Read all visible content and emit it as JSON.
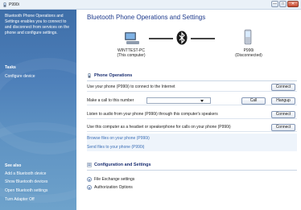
{
  "window": {
    "title": "P990i",
    "minimize": "—",
    "maximize": "□",
    "close": "✕"
  },
  "sidebar": {
    "description": "Bluetooth Phone Operations and Settings enables you to connect to and disconnect from services on the phone and configure settings.",
    "tasks_heading": "Tasks",
    "tasks": [
      {
        "label": "Configure device"
      }
    ],
    "see_also_heading": "See also",
    "see_also": [
      {
        "label": "Add a Bluetooth device"
      },
      {
        "label": "Show Bluetooth devices"
      },
      {
        "label": "Open Bluetooth settings"
      },
      {
        "label": "Turn Adapter Off"
      }
    ]
  },
  "main": {
    "title": "Bluetooth Phone Operations and Settings",
    "computer": {
      "name": "WINTTEST-PC",
      "role": "(This computer)"
    },
    "phone": {
      "name": "P990i",
      "status": "(Disconnected)"
    },
    "phone_ops": {
      "heading": "Phone Operations",
      "rows": {
        "internet": {
          "text": "Use your phone (P990i) to connect to the Internet",
          "button": "Connect"
        },
        "call": {
          "text": "Make a call to this number",
          "number_value": "",
          "call_button": "Call",
          "hangup_button": "Hangup"
        },
        "listen": {
          "text": "Listen to audio from your phone (P990i) through this computer's speakers",
          "button": "Connect"
        },
        "headset": {
          "text": "Use this computer as a headset or speakerphone for calls on your phone (P990i)",
          "button": "Connect"
        },
        "browse": {
          "text": "Browse files on your phone (P990i)"
        },
        "send": {
          "text": "Send files to your phone (P990i)"
        }
      }
    },
    "config": {
      "heading": "Configuration and Settings",
      "expanders": [
        {
          "label": "File Exchange settings"
        },
        {
          "label": "Authorization Options"
        }
      ]
    }
  },
  "colors": {
    "accent": "#1e3a8c",
    "sidebar_top": "#3e6ea8",
    "sidebar_bottom": "#6ea2cb",
    "link": "#3c6fb6"
  },
  "icons": [
    "app-icon",
    "computer-icon",
    "bluetooth-icon",
    "phone-icon",
    "phone-operations-icon",
    "configuration-icon",
    "chevron-down-icon"
  ]
}
